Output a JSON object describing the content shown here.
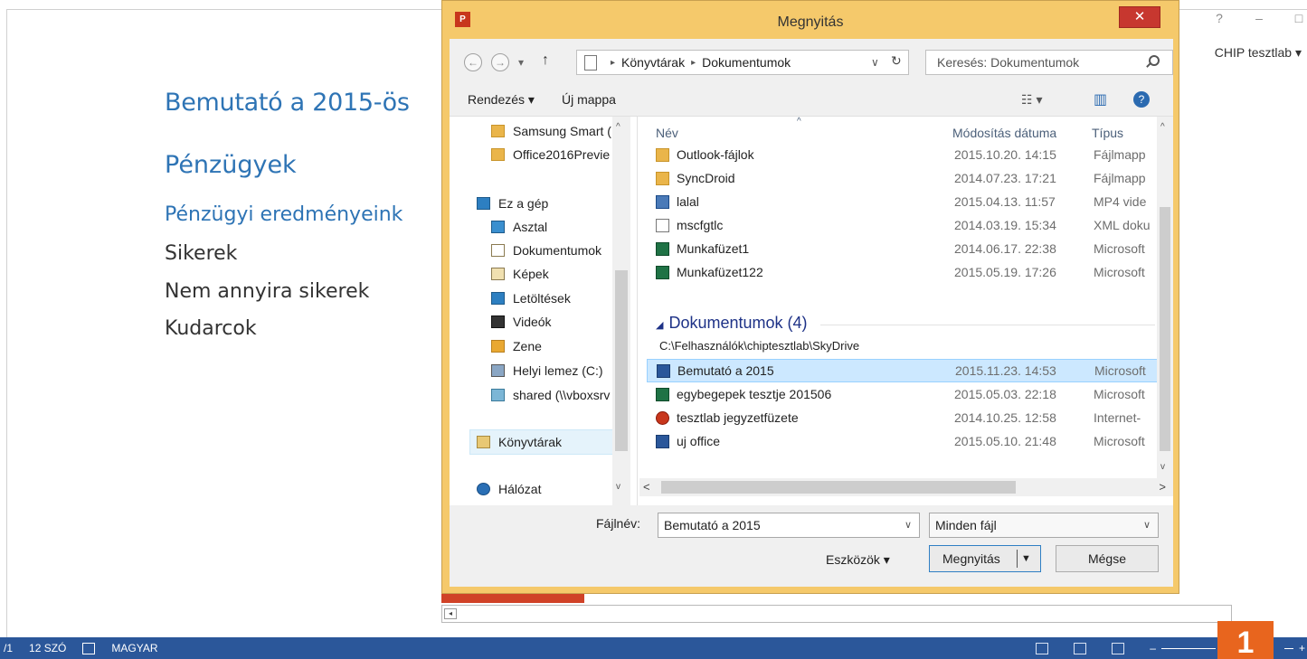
{
  "word": {
    "title_partial": "Bemutató a 2015-ös",
    "heading": "Pénzügyek",
    "subheading": "Pénzügyi eredményeink",
    "lines": [
      "Sikerek",
      "Nem annyira sikerek",
      "Kudarcok"
    ],
    "help": "?",
    "minimize": "–",
    "maximize": "□",
    "user": "CHIP tesztlab"
  },
  "statusbar": {
    "page": "/1",
    "words": "12 SZÓ",
    "lang": "MAGYAR",
    "zoom_minus": "–",
    "zoom_plus": "+"
  },
  "badge": "1",
  "dialog": {
    "app_icon": "P",
    "title": "Megnyitás",
    "close": "✕",
    "nav": {
      "back": "←",
      "forward": "→",
      "recent": "▾",
      "up": "↑"
    },
    "address": [
      "Könyvtárak",
      "Dokumentumok"
    ],
    "address_dd": "∨",
    "refresh": "↻",
    "search_placeholder": "Keresés: Dokumentumok",
    "toolbar": {
      "organize": "Rendezés ▾",
      "new_folder": "Új mappa",
      "view": "☷ ▾",
      "preview": "▥",
      "help": "?"
    },
    "nav_items": [
      {
        "label": "Samsung Smart (",
        "icon": "folder-icon"
      },
      {
        "label": "Office2016Previe",
        "icon": "folder-icon"
      },
      {
        "label": "Ez a gép",
        "icon": "computer-icon"
      },
      {
        "label": "Asztal",
        "icon": "desktop-icon"
      },
      {
        "label": "Dokumentumok",
        "icon": "documents-icon"
      },
      {
        "label": "Képek",
        "icon": "pictures-icon"
      },
      {
        "label": "Letöltések",
        "icon": "downloads-icon"
      },
      {
        "label": "Videók",
        "icon": "videos-icon"
      },
      {
        "label": "Zene",
        "icon": "music-icon"
      },
      {
        "label": "Helyi lemez (C:)",
        "icon": "drive-icon"
      },
      {
        "label": "shared (\\\\vboxsrv",
        "icon": "network-drive-icon"
      },
      {
        "label": "Könyvtárak",
        "icon": "libraries-icon"
      },
      {
        "label": "Hálózat",
        "icon": "network-icon"
      }
    ],
    "columns": {
      "name": "Név",
      "date": "Módosítás dátuma",
      "type": "Típus"
    },
    "files": [
      {
        "name": "Outlook-fájlok",
        "date": "2015.10.20. 14:15",
        "type": "Fájlmapp",
        "icon": "folder-icon"
      },
      {
        "name": "SyncDroid",
        "date": "2014.07.23. 17:21",
        "type": "Fájlmapp",
        "icon": "folder-icon"
      },
      {
        "name": "lalal",
        "date": "2015.04.13. 11:57",
        "type": "MP4 vide",
        "icon": "video-file-icon"
      },
      {
        "name": "mscfgtlc",
        "date": "2014.03.19. 15:34",
        "type": "XML doku",
        "icon": "xml-file-icon"
      },
      {
        "name": "Munkafüzet1",
        "date": "2014.06.17. 22:38",
        "type": "Microsoft",
        "icon": "excel-file-icon"
      },
      {
        "name": "Munkafüzet122",
        "date": "2015.05.19. 17:26",
        "type": "Microsoft",
        "icon": "excel-file-icon"
      }
    ],
    "group": {
      "title": "Dokumentumok (4)",
      "path": "C:\\Felhasználók\\chiptesztlab\\SkyDrive"
    },
    "group_files": [
      {
        "name": "Bemutató a 2015",
        "date": "2015.11.23. 14:53",
        "type": "Microsoft",
        "icon": "word-file-icon"
      },
      {
        "name": "egybegepek tesztje 201506",
        "date": "2015.05.03. 22:18",
        "type": "Microsoft",
        "icon": "excel-file-icon"
      },
      {
        "name": "tesztlab jegyzetfüzete",
        "date": "2014.10.25. 12:58",
        "type": "Internet-",
        "icon": "onenote-icon"
      },
      {
        "name": "uj office",
        "date": "2015.05.10. 21:48",
        "type": "Microsoft",
        "icon": "word-file-icon"
      }
    ],
    "filename_label": "Fájlnév:",
    "filename_value": "Bemutató a 2015",
    "filetype_value": "Minden fájl",
    "tools": "Eszközök ▾",
    "open": "Megnyitás",
    "cancel": "Mégse"
  }
}
